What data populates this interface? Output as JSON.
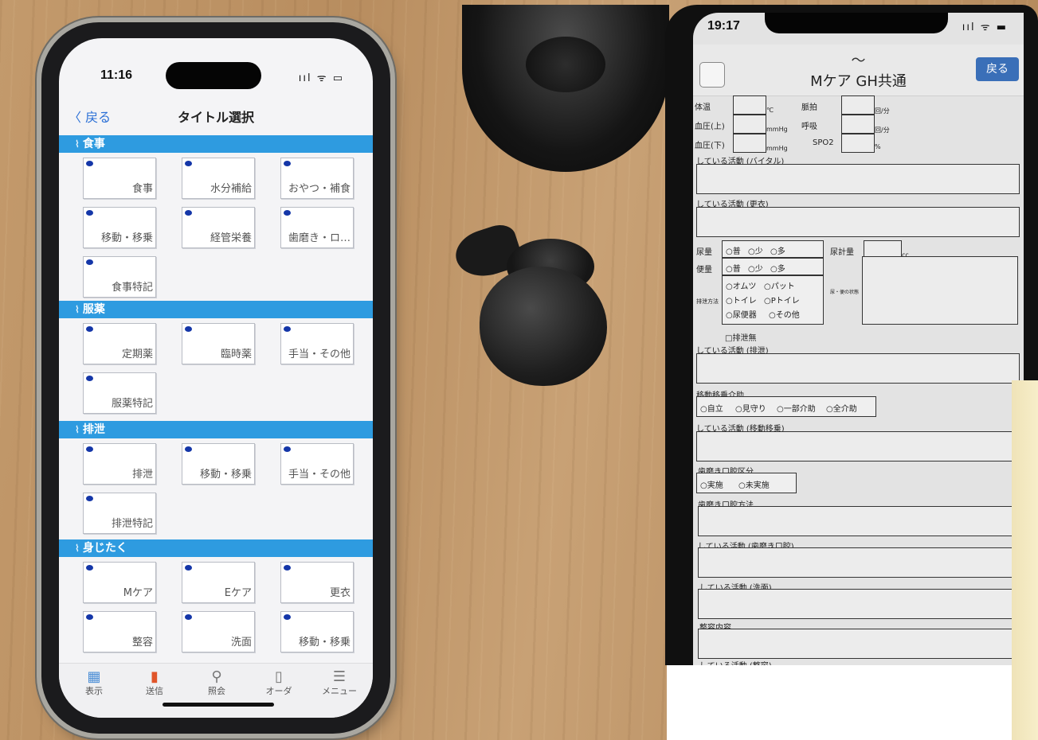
{
  "left_phone": {
    "status_time": "11:16",
    "status_icons": "ııl ᯤ ▭",
    "nav": {
      "back_label": "戻る",
      "title": "タイトル選択"
    },
    "sections": [
      {
        "title": "食事",
        "items": [
          "食事",
          "水分補給",
          "おやつ・補食",
          "移動・移乗",
          "経管栄養",
          "歯磨き・ロ…",
          "食事特記"
        ]
      },
      {
        "title": "服薬",
        "items": [
          "定期薬",
          "臨時薬",
          "手当・その他",
          "服薬特記"
        ]
      },
      {
        "title": "排泄",
        "items": [
          "排泄",
          "移動・移乗",
          "手当・その他",
          "排泄特記"
        ]
      },
      {
        "title": "身じたく",
        "items": [
          "Mケア",
          "Eケア",
          "更衣",
          "整容",
          "洗面",
          "移動・移乗"
        ]
      }
    ],
    "tabs": [
      {
        "label": "表示",
        "icon": "display-icon"
      },
      {
        "label": "送信",
        "icon": "send-icon"
      },
      {
        "label": "照会",
        "icon": "search-icon"
      },
      {
        "label": "オーダ",
        "icon": "order-icon"
      },
      {
        "label": "メニュー",
        "icon": "menu-icon"
      }
    ]
  },
  "right_phone": {
    "status_time": "19:17",
    "status_icons": "ııl ᯤ ▬",
    "header": {
      "tilde": "〜",
      "title": "Mケア GH共通",
      "back_label": "戻る"
    },
    "vitals": {
      "temp_label": "体温",
      "temp_unit": "℃",
      "pulse_label": "脈拍",
      "pulse_unit": "回/分",
      "bp_high_label": "血圧(上)",
      "bp_high_unit": "mmHg",
      "resp_label": "呼吸",
      "resp_unit": "回/分",
      "bp_low_label": "血圧(下)",
      "bp_low_unit": "mmHg",
      "spo2_label": "SPO2",
      "spo2_unit": "%"
    },
    "activity_vital": "している活動 (バイタル)",
    "activity_dress": "している活動 (更衣)",
    "urine_label": "尿量",
    "stool_label": "便量",
    "amount_options": [
      "普",
      "少",
      "多"
    ],
    "urine_meter_label": "尿計量",
    "urine_meter_unit": "cc",
    "excretion_method_label": "排泄方法",
    "excretion_options": [
      "オムツ",
      "パット",
      "トイレ",
      "Pトイレ",
      "尿便器",
      "その他"
    ],
    "stool_state_label": "尿・便の状態",
    "no_excretion": "排泄無",
    "activity_excretion": "している活動 (排泄)",
    "transfer_label": "移動移乗介助",
    "transfer_options": [
      "自立",
      "見守り",
      "一部介助",
      "全介助"
    ],
    "activity_transfer": "している活動 (移動移乗)",
    "oral_label": "歯磨き口腔区分",
    "oral_options": [
      "実施",
      "未実施"
    ],
    "oral_method": "歯磨き口腔方法",
    "activity_oral": "している活動 (歯磨き口腔)",
    "activity_wash": "している活動 (洗面)",
    "grooming": "整容内容",
    "activity_grooming": "している活動 (整容)"
  }
}
